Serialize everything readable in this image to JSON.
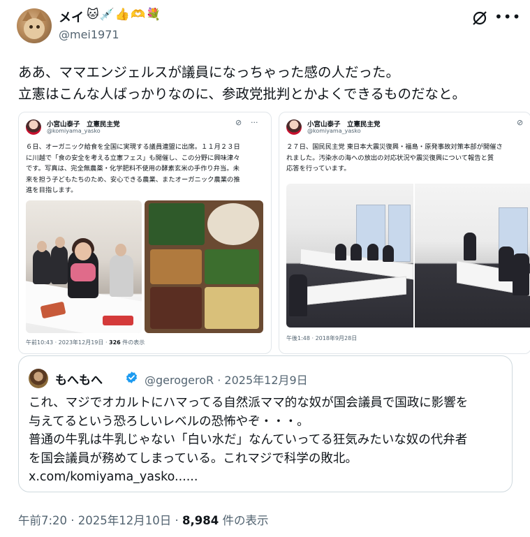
{
  "author": {
    "display_name": "メイ",
    "name_emojis": "🐱💉👍🫶💐",
    "handle": "@mei1971",
    "avatar_icon": "cat-avatar"
  },
  "header_icons": {
    "grok": "grok-icon",
    "more": "more-icon"
  },
  "tweet": {
    "lines": [
      "ああ、ママエンジェルスが議員になっちゃった感の人だった。",
      "立憲はこんな人ばっかりなのに、参政党批判とかよくできるものだなと。"
    ]
  },
  "embedded": [
    {
      "name": "小宮山泰子　立憲民主党",
      "handle": "@komiyama_yasko",
      "lines": [
        "６日、オーガニック給食を全国に実現する議員連盟に出席。１１月２３日",
        "に川越で「食の安全を考える立憲フェス」も開催し、この分野に興味津々",
        "です。写真は、完全無農薬・化学肥料不使用の酵素玄米の手作り弁当。未",
        "来を担う子どもたちのため、安心できる農業、またオーガニック農業の推",
        "進を目指します。"
      ],
      "time": "午前10:43 · 2023年12月19日 · ",
      "views": "326",
      "views_suffix": " 件の表示"
    },
    {
      "name": "小宮山泰子　立憲民主党",
      "handle": "@komiyama_yasko",
      "lines": [
        "２７日、国民民主党 東日本大震災復興・福島・原発事故対策本部が開催さ",
        "れました。汚染水の海への放出の対応状況や震災復興について報告と質",
        "応答を行っています。"
      ],
      "time": "午後1:48 · 2018年9月28日"
    }
  ],
  "quote": {
    "name": "もへもへ",
    "handle": "@gerogeroR",
    "date": "2025年12月9日",
    "lines": [
      "これ、マジでオカルトにハマってる自然派ママ的な奴が国会議員で国政に影響を",
      "与えてるという恐ろしいレベルの恐怖やぞ・・・。",
      "普通の牛乳は牛乳じゃない「白い水だ」なんていってる狂気みたいな奴の代弁者",
      "を国会議員が務めてしまっている。これマジで科学の敗北。",
      "x.com/komiyama_yasko......"
    ]
  },
  "footer": {
    "time": "午前7:20 · 2025年12月10日 · ",
    "views": "8,984",
    "views_suffix": " 件の表示"
  }
}
